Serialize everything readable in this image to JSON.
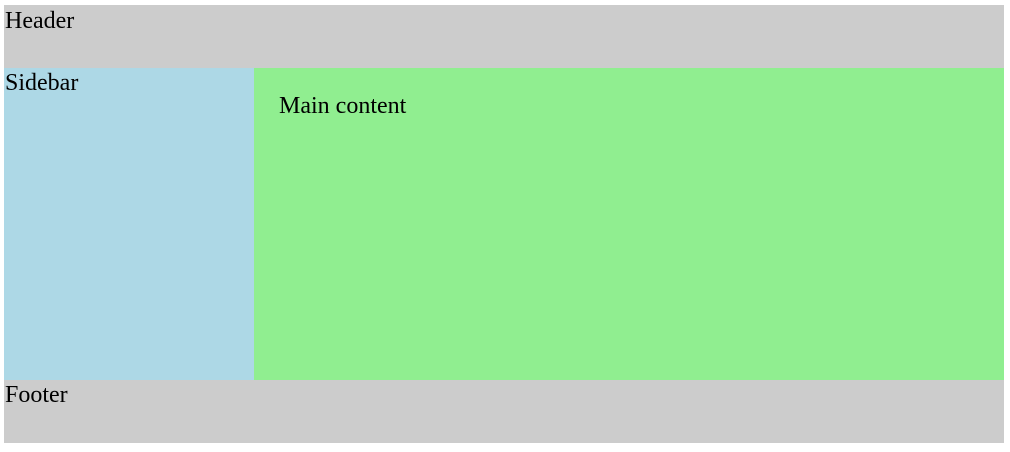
{
  "header": {
    "title": "Header"
  },
  "sidebar": {
    "title": "Sidebar"
  },
  "main": {
    "text": "Main content"
  },
  "footer": {
    "text": "Footer"
  },
  "colors": {
    "header_background": "#cccccc",
    "sidebar_background": "#add8e6",
    "main_background": "#90ee90",
    "footer_background": "#cccccc"
  }
}
